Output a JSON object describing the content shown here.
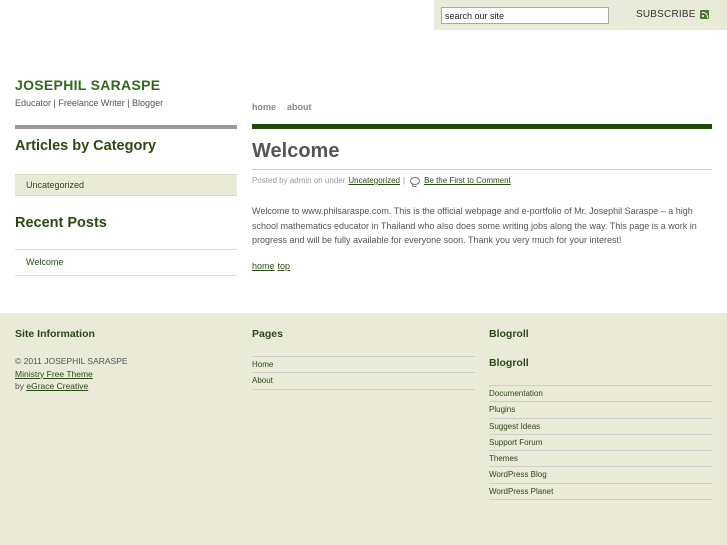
{
  "search": {
    "placeholder": "search our site",
    "value": "search our site"
  },
  "subscribe": {
    "label": "SUBSCRIBE",
    "icon": "rss-icon"
  },
  "site": {
    "title": "JOSEPHIL SARASPE",
    "tagline": "Educator | Freelance Writer | Blogger"
  },
  "nav": {
    "items": [
      {
        "label": "home"
      },
      {
        "label": "about"
      }
    ]
  },
  "sidebar": {
    "categories_heading": "Articles by Category",
    "categories": [
      {
        "label": "Uncategorized"
      }
    ],
    "recent_heading": "Recent Posts",
    "recent": [
      {
        "label": "Welcome"
      }
    ]
  },
  "post": {
    "title": "Welcome",
    "meta_prefix": "Posted by admin on under",
    "category": "Uncategorized",
    "separator": "|",
    "comment_link": "Be the First to Comment",
    "body": "Welcome to www.philsaraspe.com. This is the official webpage and e-portfolio of Mr. Josephil Saraspe – a high school mathematics educator in Thailand who also does some writing jobs along the way.  This page is a work in progress and will be fully available for everyone soon. Thank you very much for your interest!",
    "home_link": "home",
    "top_link": "top"
  },
  "footer": {
    "site_info": {
      "heading": "Site Information",
      "copyright": "© 2011 JOSEPHIL SARASPE",
      "theme_link": "Ministry Free Theme",
      "by_label": "by",
      "author_link": "eGrace Creative"
    },
    "pages": {
      "heading": "Pages",
      "items": [
        {
          "label": "Home"
        },
        {
          "label": "About"
        }
      ]
    },
    "blogroll": {
      "heading": "Blogroll",
      "subheading": "Blogroll",
      "items": [
        {
          "label": "Documentation"
        },
        {
          "label": "Plugins"
        },
        {
          "label": "Suggest Ideas"
        },
        {
          "label": "Support Forum"
        },
        {
          "label": "Themes"
        },
        {
          "label": "WordPress Blog"
        },
        {
          "label": "WordPress Planet"
        }
      ]
    }
  }
}
